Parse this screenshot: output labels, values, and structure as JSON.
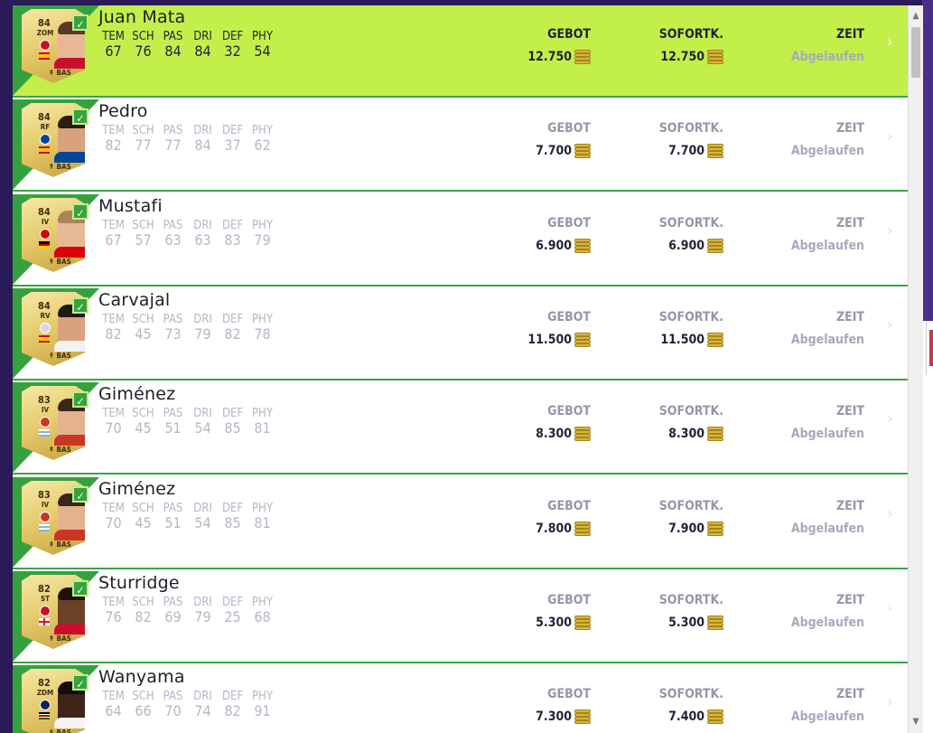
{
  "labels": {
    "bid": "GEBOT",
    "buy_now": "SOFORTK.",
    "time": "ZEIT"
  },
  "stat_keys": [
    "TEM",
    "SCH",
    "PAS",
    "DRI",
    "DEF",
    "PHY"
  ],
  "players": [
    {
      "name": "Juan Mata",
      "rating": "84",
      "position": "ZOM",
      "chemistry": "BAS",
      "stats": [
        "67",
        "76",
        "84",
        "84",
        "32",
        "54"
      ],
      "bid": "12.750",
      "buy_now": "12.750",
      "time": "Abgelaufen",
      "selected": true,
      "club_color": "#c8102e",
      "flag": "spain",
      "skin": "#e8b795",
      "hair": "#5a3a25",
      "shirt": "#c8102e"
    },
    {
      "name": "Pedro",
      "rating": "84",
      "position": "RF",
      "chemistry": "BAS",
      "stats": [
        "82",
        "77",
        "77",
        "84",
        "37",
        "62"
      ],
      "bid": "7.700",
      "buy_now": "7.700",
      "time": "Abgelaufen",
      "selected": false,
      "club_color": "#034694",
      "flag": "spain",
      "skin": "#d9a27c",
      "hair": "#2a1d15",
      "shirt": "#034694"
    },
    {
      "name": "Mustafi",
      "rating": "84",
      "position": "IV",
      "chemistry": "BAS",
      "stats": [
        "67",
        "57",
        "63",
        "63",
        "83",
        "79"
      ],
      "bid": "6.900",
      "buy_now": "6.900",
      "time": "Abgelaufen",
      "selected": false,
      "club_color": "#db0007",
      "flag": "germany",
      "skin": "#e6b995",
      "hair": "#a9855e",
      "shirt": "#db0007"
    },
    {
      "name": "Carvajal",
      "rating": "84",
      "position": "RV",
      "chemistry": "BAS",
      "stats": [
        "82",
        "45",
        "73",
        "79",
        "82",
        "78"
      ],
      "bid": "11.500",
      "buy_now": "11.500",
      "time": "Abgelaufen",
      "selected": false,
      "club_color": "#d8d8e0",
      "flag": "spain",
      "skin": "#d9a27c",
      "hair": "#231813",
      "shirt": "#f2f2f2"
    },
    {
      "name": "Giménez",
      "rating": "83",
      "position": "IV",
      "chemistry": "BAS",
      "stats": [
        "70",
        "45",
        "51",
        "54",
        "85",
        "81"
      ],
      "bid": "8.300",
      "buy_now": "8.300",
      "time": "Abgelaufen",
      "selected": false,
      "club_color": "#cb3524",
      "flag": "uruguay",
      "skin": "#e3b38e",
      "hair": "#3a271b",
      "shirt": "#cb3524"
    },
    {
      "name": "Giménez",
      "rating": "83",
      "position": "IV",
      "chemistry": "BAS",
      "stats": [
        "70",
        "45",
        "51",
        "54",
        "85",
        "81"
      ],
      "bid": "7.800",
      "buy_now": "7.900",
      "time": "Abgelaufen",
      "selected": false,
      "club_color": "#cb3524",
      "flag": "uruguay",
      "skin": "#e3b38e",
      "hair": "#3a271b",
      "shirt": "#cb3524"
    },
    {
      "name": "Sturridge",
      "rating": "82",
      "position": "ST",
      "chemistry": "BAS",
      "stats": [
        "76",
        "82",
        "69",
        "79",
        "25",
        "68"
      ],
      "bid": "5.300",
      "buy_now": "5.300",
      "time": "Abgelaufen",
      "selected": false,
      "club_color": "#c8102e",
      "flag": "england",
      "skin": "#6b4128",
      "hair": "#1c120c",
      "shirt": "#c8102e"
    },
    {
      "name": "Wanyama",
      "rating": "82",
      "position": "ZDM",
      "chemistry": "BAS",
      "stats": [
        "64",
        "66",
        "70",
        "74",
        "82",
        "91"
      ],
      "bid": "7.300",
      "buy_now": "7.400",
      "time": "Abgelaufen",
      "selected": false,
      "club_color": "#132257",
      "flag": "kenya",
      "skin": "#3d2518",
      "hair": "#140c08",
      "shirt": "#f4f4f4"
    }
  ],
  "icons": {
    "coins": "coins-icon",
    "chevron": "chevron-right-icon",
    "check": "check-icon"
  }
}
